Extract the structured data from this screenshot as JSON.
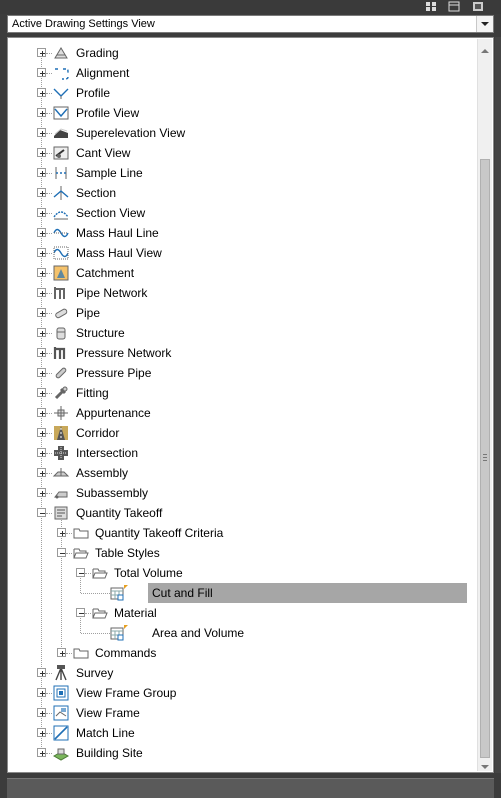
{
  "dropdown": {
    "value": "Active Drawing Settings View"
  },
  "tree": {
    "items": [
      {
        "label": "Grading",
        "icon": "grading-icon"
      },
      {
        "label": "Alignment",
        "icon": "alignment-icon"
      },
      {
        "label": "Profile",
        "icon": "profile-icon"
      },
      {
        "label": "Profile View",
        "icon": "profile-view-icon"
      },
      {
        "label": "Superelevation View",
        "icon": "superelevation-view-icon"
      },
      {
        "label": "Cant View",
        "icon": "cant-view-icon"
      },
      {
        "label": "Sample Line",
        "icon": "sample-line-icon"
      },
      {
        "label": "Section",
        "icon": "section-icon"
      },
      {
        "label": "Section View",
        "icon": "section-view-icon"
      },
      {
        "label": "Mass Haul Line",
        "icon": "mass-haul-line-icon"
      },
      {
        "label": "Mass Haul View",
        "icon": "mass-haul-view-icon"
      },
      {
        "label": "Catchment",
        "icon": "catchment-icon"
      },
      {
        "label": "Pipe Network",
        "icon": "pipe-network-icon"
      },
      {
        "label": "Pipe",
        "icon": "pipe-icon"
      },
      {
        "label": "Structure",
        "icon": "structure-icon"
      },
      {
        "label": "Pressure Network",
        "icon": "pressure-network-icon"
      },
      {
        "label": "Pressure Pipe",
        "icon": "pressure-pipe-icon"
      },
      {
        "label": "Fitting",
        "icon": "fitting-icon"
      },
      {
        "label": "Appurtenance",
        "icon": "appurtenance-icon"
      },
      {
        "label": "Corridor",
        "icon": "corridor-icon"
      },
      {
        "label": "Intersection",
        "icon": "intersection-icon"
      },
      {
        "label": "Assembly",
        "icon": "assembly-icon"
      },
      {
        "label": "Subassembly",
        "icon": "subassembly-icon"
      },
      {
        "label": "Quantity Takeoff",
        "icon": "quantity-takeoff-icon"
      },
      {
        "label": "Quantity Takeoff Criteria",
        "icon": "folder-icon"
      },
      {
        "label": "Table Styles",
        "icon": "folder-open-icon"
      },
      {
        "label": "Total Volume",
        "icon": "folder-open-icon"
      },
      {
        "label": "Cut and Fill",
        "icon": "table-style-icon"
      },
      {
        "label": "Material",
        "icon": "folder-open-icon"
      },
      {
        "label": "Area and Volume",
        "icon": "table-style-icon"
      },
      {
        "label": "Commands",
        "icon": "folder-icon"
      },
      {
        "label": "Survey",
        "icon": "survey-icon"
      },
      {
        "label": "View Frame Group",
        "icon": "view-frame-group-icon"
      },
      {
        "label": "View Frame",
        "icon": "view-frame-icon"
      },
      {
        "label": "Match Line",
        "icon": "match-line-icon"
      },
      {
        "label": "Building Site",
        "icon": "building-site-icon"
      }
    ],
    "selected": "Cut and Fill"
  },
  "colors": {
    "selection": "#a6a6a6",
    "icon_blue": "#1f6fb5",
    "icon_gray": "#666666",
    "accent_orange": "#e8a020"
  }
}
